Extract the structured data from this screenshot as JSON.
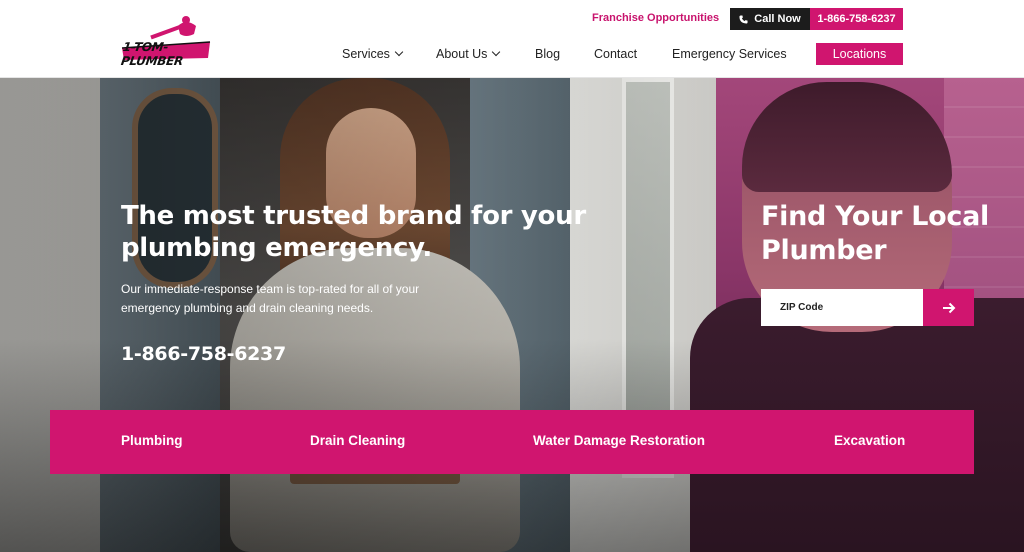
{
  "brand": {
    "name": "1-TOM-PLUMBER",
    "accent": "#d0156f"
  },
  "topbar": {
    "franchise_link": "Franchise Opportunities",
    "call_now_label": "Call Now",
    "phone": "1-866-758-6237"
  },
  "nav": {
    "items": [
      {
        "label": "Services",
        "has_dropdown": true
      },
      {
        "label": "About Us",
        "has_dropdown": true
      },
      {
        "label": "Blog",
        "has_dropdown": false
      },
      {
        "label": "Contact",
        "has_dropdown": false
      },
      {
        "label": "Emergency Services",
        "has_dropdown": false
      }
    ],
    "locations_label": "Locations"
  },
  "hero": {
    "title": "The most trusted brand for your plumbing emergency.",
    "description": "Our immediate-response team is top-rated for all of your emergency plumbing and drain cleaning needs.",
    "phone": "1-866-758-6237"
  },
  "finder": {
    "title": "Find Your Local Plumber",
    "zip_placeholder": "ZIP Code",
    "submit_icon": "arrow-right-icon"
  },
  "services": [
    {
      "label": "Plumbing"
    },
    {
      "label": "Drain Cleaning"
    },
    {
      "label": "Water Damage Restoration"
    },
    {
      "label": "Excavation"
    }
  ]
}
